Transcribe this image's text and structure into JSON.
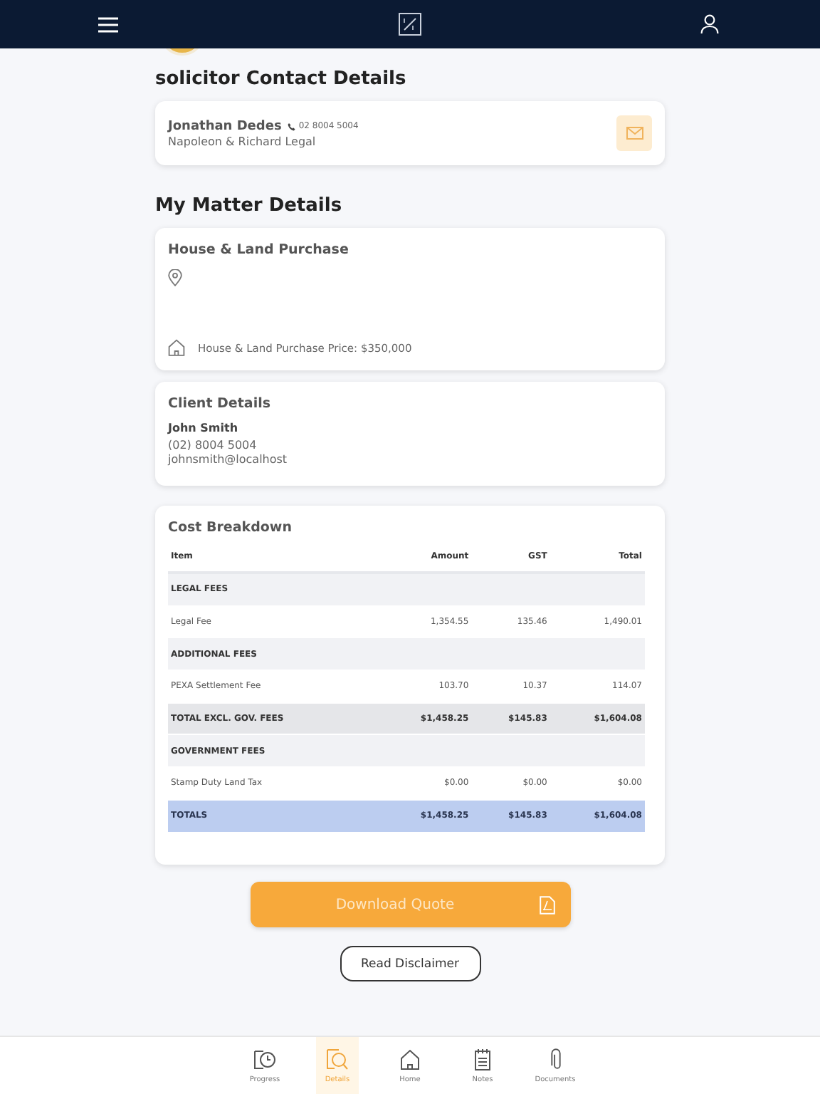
{
  "solicitor": {
    "heading": "solicitor Contact Details",
    "name": "Jonathan Dedes",
    "phone": "02 8004 5004",
    "firm": "Napoleon & Richard Legal"
  },
  "matter": {
    "heading": "My Matter Details",
    "title": "House & Land Purchase",
    "price": "House & Land Purchase Price: $350,000"
  },
  "client": {
    "title": "Client Details",
    "name": "John Smith",
    "phone": "(02) 8004 5004",
    "email": "johnsmith@localhost"
  },
  "costs": {
    "title": "Cost Breakdown",
    "columns": [
      "Item",
      "Amount",
      "GST",
      "Total"
    ],
    "rows": [
      {
        "kind": "section",
        "cells": [
          "LEGAL FEES"
        ]
      },
      {
        "kind": "item",
        "cells": [
          "Legal Fee",
          "1,354.55",
          "135.46",
          "1,490.01"
        ]
      },
      {
        "kind": "section",
        "cells": [
          "ADDITIONAL FEES"
        ]
      },
      {
        "kind": "item",
        "cells": [
          "PEXA Settlement Fee",
          "103.70",
          "10.37",
          "114.07"
        ]
      },
      {
        "kind": "subtotal",
        "cells": [
          "TOTAL EXCL. GOV. FEES",
          "$1,458.25",
          "$145.83",
          "$1,604.08"
        ]
      },
      {
        "kind": "section",
        "cells": [
          "GOVERNMENT FEES"
        ]
      },
      {
        "kind": "item",
        "cells": [
          "Stamp Duty Land Tax",
          "$0.00",
          "$0.00",
          "$0.00"
        ]
      },
      {
        "kind": "total",
        "cells": [
          "TOTALS",
          "$1,458.25",
          "$145.83",
          "$1,604.08"
        ]
      }
    ]
  },
  "buttons": {
    "download": "Download Quote",
    "disclaimer": "Read Disclaimer"
  },
  "nav": [
    {
      "label": "Progress",
      "kind": "progress",
      "selected": false
    },
    {
      "label": "Details",
      "kind": "details",
      "selected": true
    },
    {
      "label": "Home",
      "kind": "home",
      "selected": false
    },
    {
      "label": "Notes",
      "kind": "notes",
      "selected": false
    },
    {
      "label": "Documents",
      "kind": "documents",
      "selected": false
    }
  ]
}
